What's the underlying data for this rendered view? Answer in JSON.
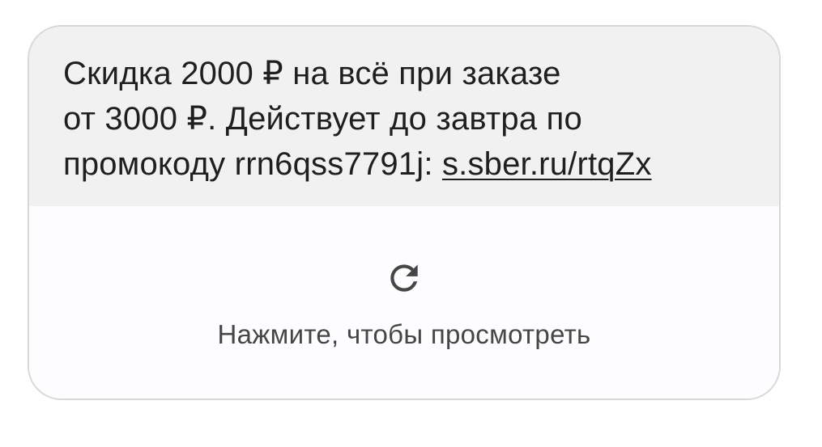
{
  "message": {
    "line1": "Скидка 2000 ₽ на всё при заказе",
    "line2": "от 3000 ₽. Действует до завтра по",
    "line3_prefix": "промокоду rrn6qss7791j: ",
    "link_text": "s.sber.ru/rtqZx"
  },
  "preview": {
    "icon": "refresh-icon",
    "label": "Нажмите, чтобы просмотреть"
  }
}
